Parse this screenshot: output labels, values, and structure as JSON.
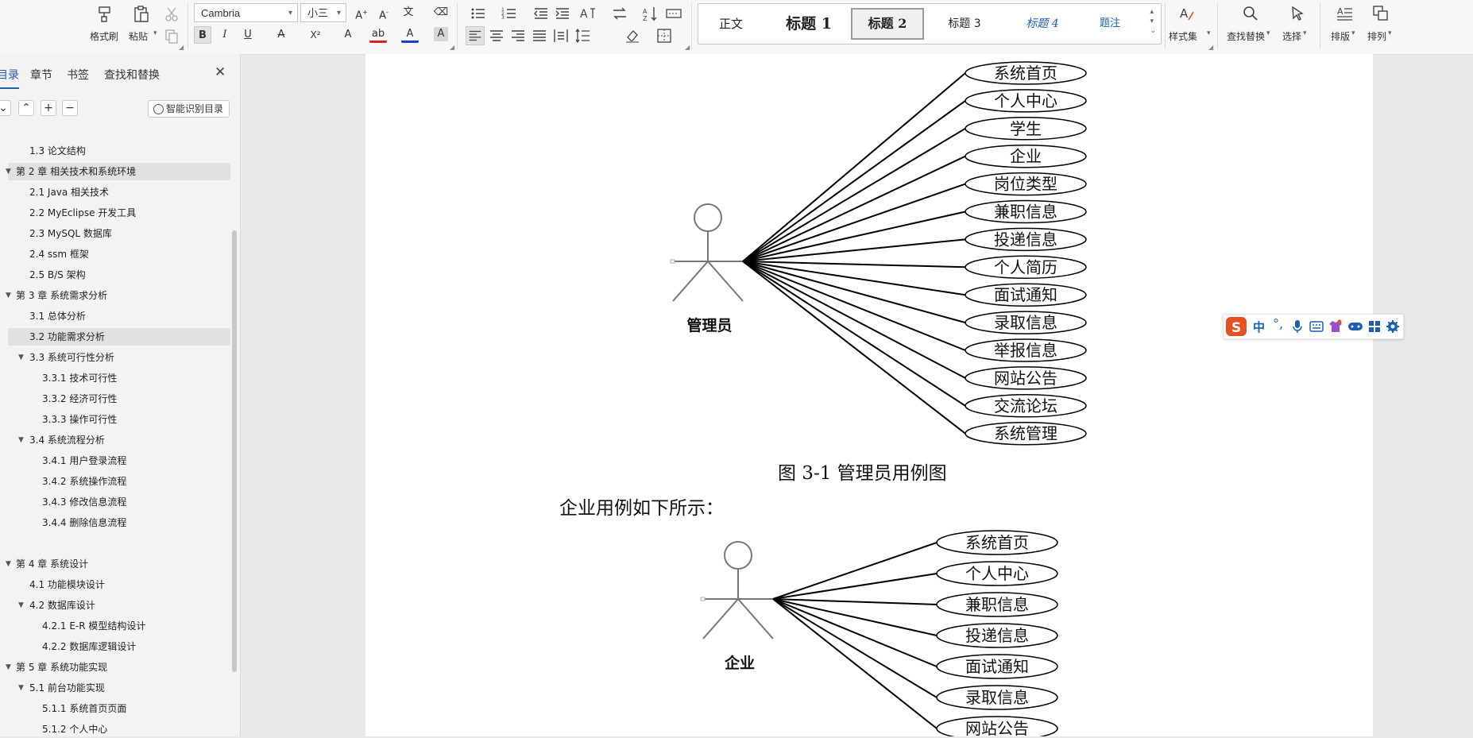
{
  "ribbon": {
    "format_painter": "格式刷",
    "paste": "粘贴",
    "font_name": "Cambria",
    "font_size": "小三",
    "styles": {
      "normal": "正文",
      "heading1": "标题 1",
      "heading2": "标题 2",
      "heading3": "标题 3",
      "heading4": "标题 4",
      "caption": "题注"
    },
    "style_set": "样式集",
    "find_replace": "查找替换",
    "select": "选择",
    "layout": "排版",
    "arrange": "排列"
  },
  "sidebar": {
    "tabs": [
      "目录",
      "章节",
      "书签",
      "查找和替换"
    ],
    "smart_toc": "智能识别目录",
    "items": [
      {
        "label": "1.3 论文结构",
        "level": 2,
        "expanded": null,
        "selected": false
      },
      {
        "label": "第 2 章  相关技术和系统环境",
        "level": 1,
        "expanded": true,
        "selected": true
      },
      {
        "label": "2.1 Java 相关技术",
        "level": 2,
        "expanded": null,
        "selected": false
      },
      {
        "label": "2.2 MyEclipse 开发工具",
        "level": 2,
        "expanded": null,
        "selected": false
      },
      {
        "label": "2.3 MySQL 数据库",
        "level": 2,
        "expanded": null,
        "selected": false
      },
      {
        "label": "2.4 ssm 框架",
        "level": 2,
        "expanded": null,
        "selected": false
      },
      {
        "label": "2.5 B/S 架构",
        "level": 2,
        "expanded": null,
        "selected": false
      },
      {
        "label": "第 3 章  系统需求分析",
        "level": 1,
        "expanded": true,
        "selected": false
      },
      {
        "label": "3.1 总体分析",
        "level": 2,
        "expanded": null,
        "selected": false
      },
      {
        "label": "3.2 功能需求分析",
        "level": 2,
        "expanded": null,
        "selected": true
      },
      {
        "label": "3.3  系统可行性分析",
        "level": 2,
        "expanded": true,
        "selected": false
      },
      {
        "label": "3.3.1 技术可行性",
        "level": 3,
        "expanded": null,
        "selected": false
      },
      {
        "label": "3.3.2 经济可行性",
        "level": 3,
        "expanded": null,
        "selected": false
      },
      {
        "label": "3.3.3 操作可行性",
        "level": 3,
        "expanded": null,
        "selected": false
      },
      {
        "label": "3.4 系统流程分析",
        "level": 2,
        "expanded": true,
        "selected": false
      },
      {
        "label": "3.4.1  用户登录流程",
        "level": 3,
        "expanded": null,
        "selected": false
      },
      {
        "label": "3.4.2  系统操作流程",
        "level": 3,
        "expanded": null,
        "selected": false
      },
      {
        "label": "3.4.3 修改信息流程",
        "level": 3,
        "expanded": null,
        "selected": false
      },
      {
        "label": "3.4.4 删除信息流程",
        "level": 3,
        "expanded": null,
        "selected": false
      },
      {
        "label": "",
        "level": 3,
        "expanded": null,
        "selected": false
      },
      {
        "label": "第 4 章  系统设计",
        "level": 1,
        "expanded": true,
        "selected": false
      },
      {
        "label": "4.1  功能模块设计",
        "level": 2,
        "expanded": null,
        "selected": false
      },
      {
        "label": "4.2  数据库设计",
        "level": 2,
        "expanded": true,
        "selected": false
      },
      {
        "label": "4.2.1 E-R 模型结构设计",
        "level": 3,
        "expanded": null,
        "selected": false
      },
      {
        "label": "4.2.2  数据库逻辑设计",
        "level": 3,
        "expanded": null,
        "selected": false
      },
      {
        "label": "第 5 章  系统功能实现",
        "level": 1,
        "expanded": true,
        "selected": false
      },
      {
        "label": "5.1 前台功能实现",
        "level": 2,
        "expanded": true,
        "selected": false
      },
      {
        "label": "5.1.1 系统首页页面",
        "level": 3,
        "expanded": null,
        "selected": false
      },
      {
        "label": "5.1.2 个人中心",
        "level": 3,
        "expanded": null,
        "selected": false
      }
    ]
  },
  "document": {
    "diagram1": {
      "actor": "管理员",
      "use_cases": [
        "系统首页",
        "个人中心",
        "学生",
        "企业",
        "岗位类型",
        "兼职信息",
        "投递信息",
        "个人简历",
        "面试通知",
        "录取信息",
        "举报信息",
        "网站公告",
        "交流论坛",
        "系统管理"
      ]
    },
    "caption1": "图 3-1  管理员用例图",
    "paragraph1": "企业用例如下所示：",
    "diagram2": {
      "actor": "企业",
      "use_cases": [
        "系统首页",
        "个人中心",
        "兼职信息",
        "投递信息",
        "面试通知",
        "录取信息",
        "网站公告"
      ]
    }
  },
  "ime": {
    "mode": "中"
  },
  "colors": {
    "accent": "#1a5fb4",
    "ime_logo": "#e8501f",
    "font_color_red": "#e02020",
    "font_color_blue": "#1c3fd6"
  }
}
